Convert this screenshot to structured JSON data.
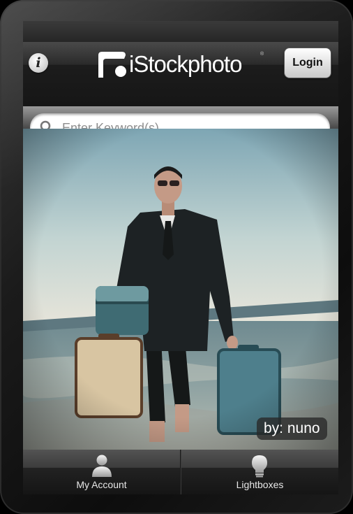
{
  "navbar": {
    "info_icon": "info-icon",
    "logo_text": "iStockphoto",
    "logo_trademark": "®",
    "login_label": "Login"
  },
  "search": {
    "placeholder": "Enter Keyword(s)",
    "value": ""
  },
  "photo": {
    "credit": "by: nuno"
  },
  "tabbar": {
    "items": [
      {
        "label": "My Account",
        "icon": "person-icon"
      },
      {
        "label": "Lightboxes",
        "icon": "lightbulb-icon"
      }
    ]
  },
  "colors": {
    "navbar": "#1c1c1c",
    "login_button": "#e6e6e6",
    "search_field": "#ffffff"
  }
}
